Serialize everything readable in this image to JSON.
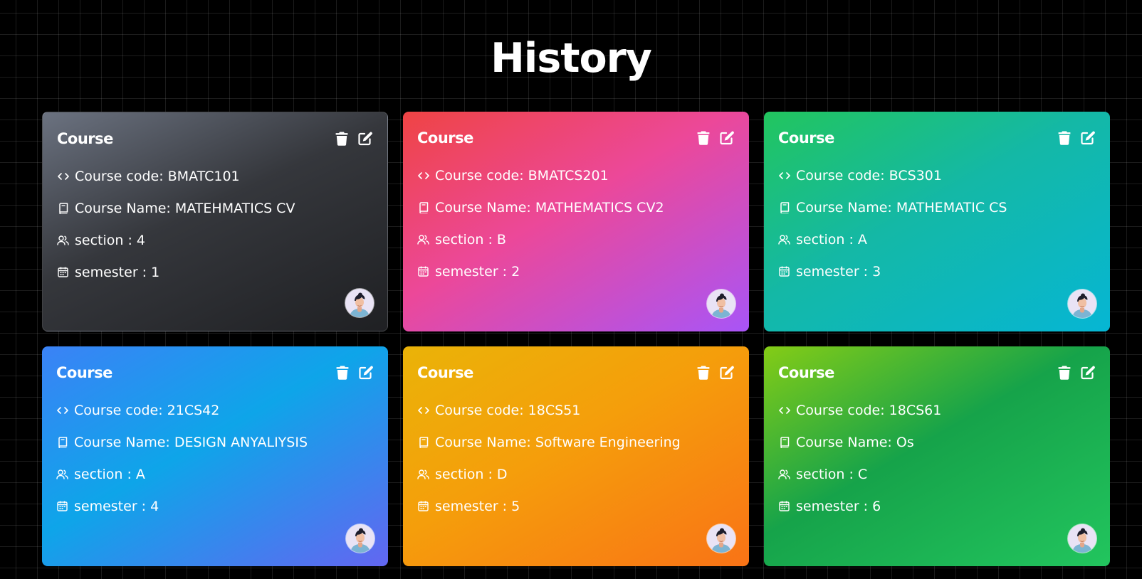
{
  "page": {
    "title": "History"
  },
  "labels": {
    "code_prefix": "Course code: ",
    "name_prefix": "Course Name: ",
    "section_prefix": "section : ",
    "semester_prefix": "semester : "
  },
  "icons": {
    "delete": "trash-icon",
    "edit": "edit-icon",
    "code": "code-brackets-icon",
    "name": "book-icon",
    "section": "users-icon",
    "semester": "calendar-icon",
    "avatar": "user-avatar"
  },
  "cards": [
    {
      "title": "Course",
      "code": "BMATC101",
      "name": "MATEHMATICS CV",
      "section": "4",
      "semester": "1",
      "gradient": [
        "#6b7280",
        "#1f2023"
      ]
    },
    {
      "title": "Course",
      "code": "BMATCS201",
      "name": "MATHEMATICS CV2",
      "section": "B",
      "semester": "2",
      "gradient": [
        "#ef4444",
        "#ec4899",
        "#a855f7"
      ]
    },
    {
      "title": "Course",
      "code": "BCS301",
      "name": "MATHEMATIC CS",
      "section": "A",
      "semester": "3",
      "gradient": [
        "#22c55e",
        "#14b8a6",
        "#06b6d4"
      ]
    },
    {
      "title": "Course",
      "code": "21CS42",
      "name": "DESIGN ANYALIYSIS",
      "section": "A",
      "semester": "4",
      "gradient": [
        "#3b82f6",
        "#0ea5e9",
        "#6366f1"
      ]
    },
    {
      "title": "Course",
      "code": "18CS51",
      "name": "Software Engineering",
      "section": "D",
      "semester": "5",
      "gradient": [
        "#eab308",
        "#f59e0b",
        "#f97316"
      ]
    },
    {
      "title": "Course",
      "code": "18CS61",
      "name": "Os",
      "section": "C",
      "semester": "6",
      "gradient": [
        "#84cc16",
        "#16a34a",
        "#22c55e"
      ]
    }
  ]
}
